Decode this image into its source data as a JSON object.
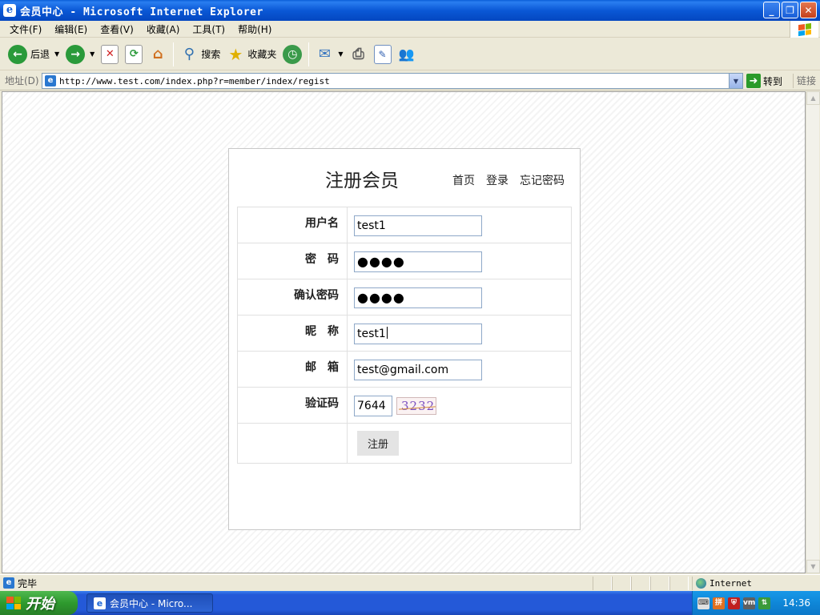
{
  "window": {
    "title": "会员中心 - Microsoft Internet Explorer"
  },
  "menu": [
    {
      "label": "文件(F)"
    },
    {
      "label": "编辑(E)"
    },
    {
      "label": "查看(V)"
    },
    {
      "label": "收藏(A)"
    },
    {
      "label": "工具(T)"
    },
    {
      "label": "帮助(H)"
    }
  ],
  "toolbar": {
    "back_label": "后退",
    "search_label": "搜索",
    "favorites_label": "收藏夹"
  },
  "address": {
    "label": "地址(D)",
    "url": "http://www.test.com/index.php?r=member/index/regist",
    "go_label": "转到",
    "links_label": "链接"
  },
  "page": {
    "title": "注册会员",
    "nav_links": [
      {
        "label": "首页"
      },
      {
        "label": "登录"
      },
      {
        "label": "忘记密码"
      }
    ],
    "form": {
      "username_label": "用户名",
      "username_value": "test1",
      "password_label": "密　码",
      "password_value": "●●●●",
      "confirm_label": "确认密码",
      "confirm_value": "●●●●",
      "nickname_label": "昵　称",
      "nickname_value": "test1",
      "email_label": "邮　箱",
      "email_value": "test@gmail.com",
      "captcha_label": "验证码",
      "captcha_value": "7644",
      "captcha_image_text": "3232",
      "submit_label": "注册"
    }
  },
  "status": {
    "text": "完毕",
    "zone": "Internet"
  },
  "taskbar": {
    "start_label": "开始",
    "task_label": "会员中心 - Micro...",
    "clock": "14:36"
  }
}
